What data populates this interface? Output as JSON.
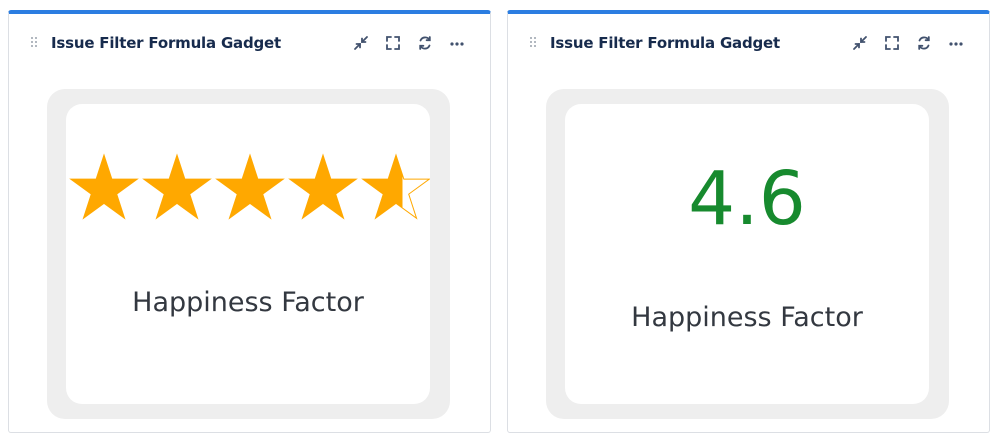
{
  "gadgets": [
    {
      "title": "Issue Filter Formula Gadget",
      "label": "Happiness Factor",
      "rating": 4.6,
      "max_rating": 5,
      "star_color": "#ffa800"
    },
    {
      "title": "Issue Filter Formula Gadget",
      "label": "Happiness Factor",
      "value": "4.6",
      "value_color": "#178a2e"
    }
  ],
  "header_icons": [
    "minimize-icon",
    "fullscreen-icon",
    "refresh-icon",
    "more-icon"
  ],
  "colors": {
    "accent": "#2b7de1",
    "title": "#172b4d",
    "frame": "#eeeeee"
  }
}
